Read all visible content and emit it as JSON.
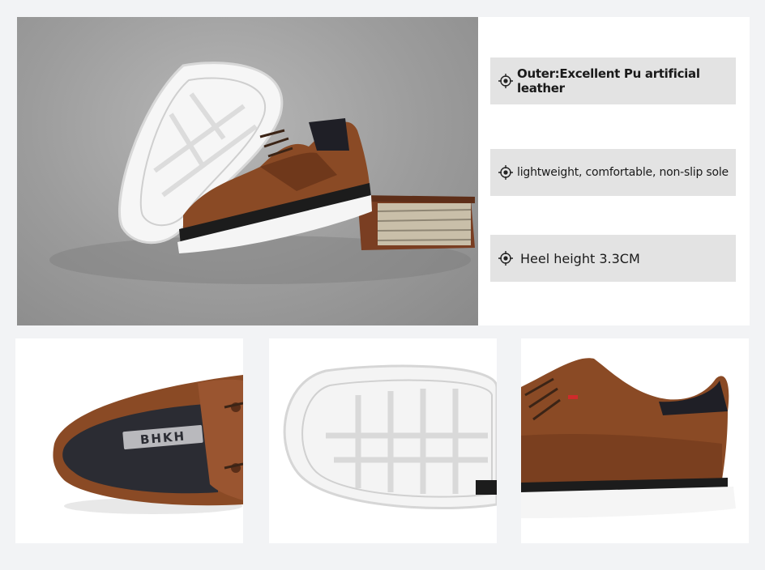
{
  "features": [
    {
      "text": "Outer:Excellent Pu artificial leather",
      "icon": "crosshair-icon"
    },
    {
      "text": "lightweight, comfortable, non-slip sole",
      "icon": "crosshair-icon"
    },
    {
      "text": "Heel height 3.3CM",
      "icon": "crosshair-icon"
    }
  ],
  "insole_brand": "BHKH",
  "colors": {
    "leather": "#8a4a25",
    "sole": "#f4f4f4",
    "background": "#f2f3f5",
    "feature_box": "#e3e3e3"
  }
}
